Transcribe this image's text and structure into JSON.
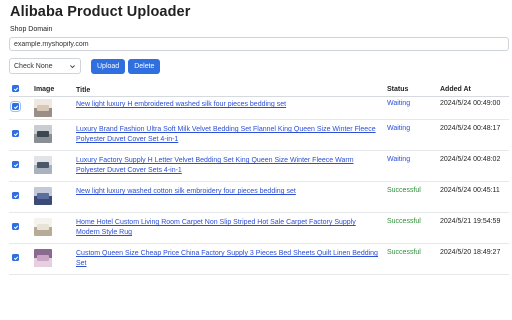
{
  "app": {
    "title": "Alibaba Product Uploader"
  },
  "shop": {
    "label": "Shop Domain",
    "value": "example.myshopify.com"
  },
  "toolbar": {
    "check_select": "Check None",
    "upload_label": "Upload",
    "delete_label": "Delete"
  },
  "table": {
    "columns": {
      "image": "Image",
      "title": "Title",
      "status": "Status",
      "added": "Added At"
    },
    "rows": [
      {
        "checked": true,
        "title": "New light luxury H embroidered washed silk four pieces bedding set",
        "status": "Waiting",
        "status_color": "#2c4fd6",
        "added": "2024/5/24 00:49:00",
        "thumb_colors": [
          "#d8c8b8",
          "#9a8f86",
          "#efe7e0"
        ]
      },
      {
        "checked": true,
        "title": "Luxury Brand Fashion Ultra Soft Milk Velvet Bedding Set Flannel King Queen Size Winter Fleece Polyester Duvet Cover Set 4-in-1",
        "status": "Waiting",
        "status_color": "#2c4fd6",
        "added": "2024/5/24 00:48:17",
        "thumb_colors": [
          "#3d4752",
          "#8a8f96",
          "#c9ccd1"
        ]
      },
      {
        "checked": true,
        "title": "Luxury Factory Supply H Letter Velvet Bedding Set King Queen Size Winter Fleece Warm Polyester Duvet Cover Sets 4-in-1",
        "status": "Waiting",
        "status_color": "#2c4fd6",
        "added": "2024/5/24 00:48:02",
        "thumb_colors": [
          "#4a5868",
          "#a8b3bf",
          "#e0e4e8"
        ]
      },
      {
        "checked": true,
        "title": "New light luxury washed cotton silk embroidery four pieces bedding set",
        "status": "Successful",
        "status_color": "#2f8f3a",
        "added": "2024/5/24 00:45:11",
        "thumb_colors": [
          "#5a6ea0",
          "#3b4a76",
          "#c3c9d8"
        ]
      },
      {
        "checked": true,
        "title": "Home Hotel Custom Living Room Carpet Non Slip Striped Hot Sale Carpet Factory Supply Modern Style Rug",
        "status": "Successful",
        "status_color": "#2f8f3a",
        "added": "2024/5/21 19:54:59",
        "thumb_colors": [
          "#e9e3d7",
          "#b8ab95",
          "#f6f3ee"
        ]
      },
      {
        "checked": true,
        "title": "Custom Queen Size Cheap Price China Factory Supply 3 Pieces Bed Sheets Quilt Linen Bedding Set",
        "status": "Successful",
        "status_color": "#2f8f3a",
        "added": "2024/5/20 18:49:27",
        "thumb_colors": [
          "#c9a6c4",
          "#e6cfe0",
          "#8a6a90"
        ]
      }
    ]
  }
}
